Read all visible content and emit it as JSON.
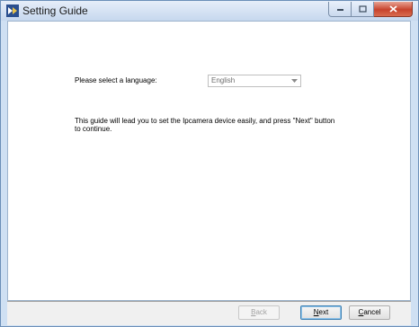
{
  "window": {
    "title": "Setting Guide",
    "app_icon": "setting-guide-app-icon"
  },
  "caption_buttons": {
    "minimize_icon": "minimize-icon",
    "maximize_icon": "maximize-icon",
    "close_icon": "close-icon"
  },
  "language": {
    "label": "Please select a language:",
    "selected": "English",
    "dropdown_icon": "chevron-down-icon"
  },
  "guide": {
    "text": "This guide will lead you to set the Ipcamera device easily, and press \"Next\" button to continue."
  },
  "buttons": {
    "back_mnemonic": "B",
    "back_rest": "ack",
    "next_mnemonic": "N",
    "next_rest": "ext",
    "cancel_mnemonic": "C",
    "cancel_rest": "ancel"
  },
  "colors": {
    "titlebar": "#c6d8ee",
    "close_button": "#c7432c",
    "frame": "#cfe0f3",
    "disabled_text": "#a2a2a2"
  }
}
